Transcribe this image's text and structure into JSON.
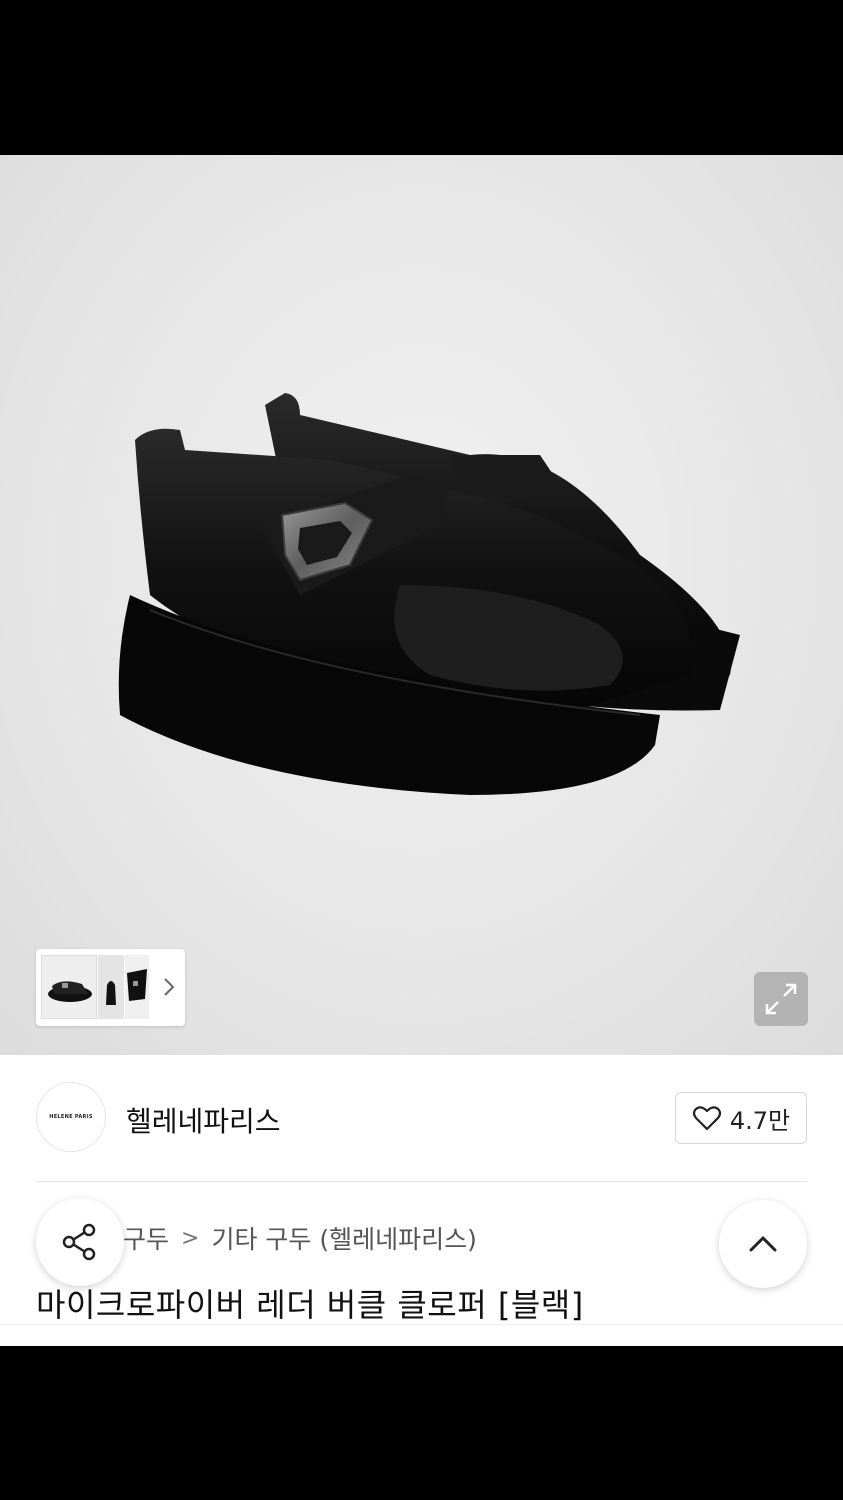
{
  "product": {
    "image_alt": "",
    "thumbnails": [
      "thumbnail-1",
      "thumbnail-2",
      "thumbnail-3"
    ],
    "title": "마이크로파이버 레더 버클 클로퍼 [블랙]"
  },
  "brand": {
    "logo_text": "HELENE PARIS",
    "name": "헬레네파리스",
    "likes": "4.7만"
  },
  "breadcrumb": {
    "items": [
      "구두",
      "기타 구두 (헬레네파리스)"
    ],
    "separator": ">"
  },
  "icons": {
    "thumb_next": "chevron-right-icon",
    "expand": "expand-icon",
    "like": "heart-icon",
    "share": "share-icon",
    "scroll_top": "chevron-up-icon"
  },
  "colors": {
    "background": "#ffffff",
    "image_bg": "#e6e6e6",
    "text": "#111111",
    "muted": "#555555"
  }
}
